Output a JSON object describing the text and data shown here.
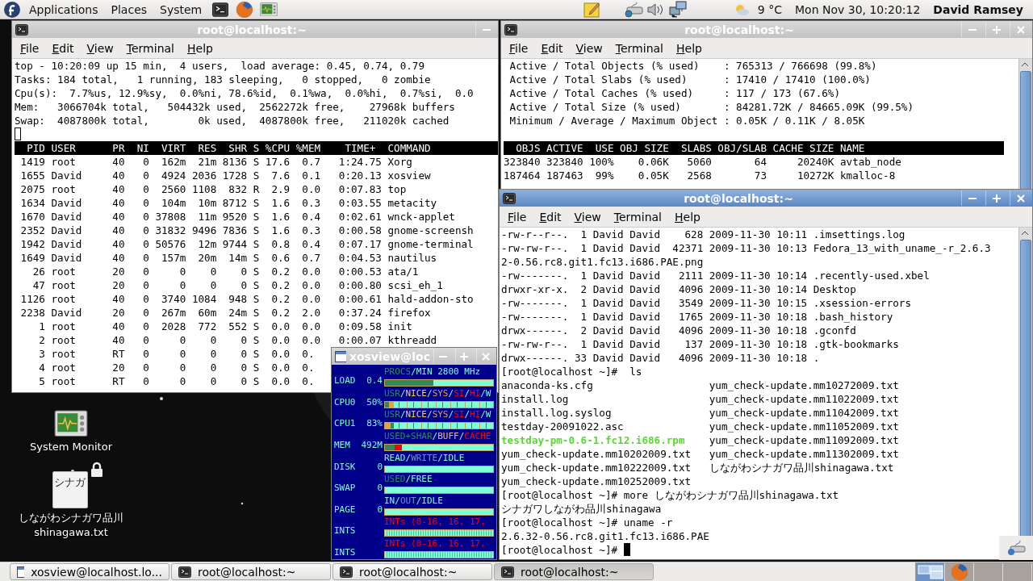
{
  "top_panel": {
    "menus": [
      "Applications",
      "Places",
      "System"
    ],
    "temperature": "9 °C",
    "clock": "Mon Nov 30, 10:20:12",
    "user": "David Ramsey"
  },
  "desktop_icons": [
    {
      "kind": "monitor",
      "label_lines": [
        "System Monitor"
      ]
    },
    {
      "kind": "file",
      "thumbnail_text": "シナガ",
      "label_lines": [
        "しながわシナガワ品川",
        "shinagawa.txt"
      ],
      "locked": true
    }
  ],
  "top_window": {
    "title": "root@localhost:~",
    "active": false,
    "menu": [
      "File",
      "Edit",
      "View",
      "Terminal",
      "Help"
    ],
    "summary": [
      "top - 10:20:09 up 15 min,  4 users,  load average: 0.45, 0.74, 0.79",
      "Tasks: 184 total,   1 running, 183 sleeping,   0 stopped,   0 zombie",
      "Cpu(s):  7.7%us, 12.9%sy,  0.0%ni, 78.6%id,  0.1%wa,  0.0%hi,  0.7%si,  0.0",
      "Mem:   3066704k total,   504432k used,  2562272k free,    27968k buffers",
      "Swap:  4087800k total,        0k used,  4087800k free,   211020k cached"
    ],
    "header": "  PID USER      PR  NI  VIRT  RES  SHR S %CPU %MEM    TIME+  COMMAND",
    "rows": [
      " 1419 root      40   0  162m  21m 8136 S 17.6  0.7   1:24.75 Xorg",
      " 1655 David     40   0  4924 2036 1728 S  7.6  0.1   0:20.13 xosview",
      " 2075 root      40   0  2560 1108  832 R  2.9  0.0   0:07.83 top",
      " 1634 David     40   0  104m  10m 8712 S  1.6  0.3   0:03.55 metacity",
      " 1670 David     40   0 37808  11m 9520 S  1.6  0.4   0:02.61 wnck-applet",
      " 2352 David     40   0 31832 9496 7836 S  1.6  0.3   0:00.58 gnome-screensh",
      " 1942 David     40   0 50576  12m 9744 S  0.8  0.4   0:07.17 gnome-terminal",
      " 1649 David     40   0  157m  20m  14m S  0.6  0.7   0:04.53 nautilus",
      "   26 root      20   0     0    0    0 S  0.2  0.0   0:00.53 ata/1",
      "   47 root      20   0     0    0    0 S  0.2  0.0   0:00.80 scsi_eh_1",
      " 1126 root      40   0  3740 1084  948 S  0.2  0.0   0:00.61 hald-addon-sto",
      " 2238 David     20   0  267m  60m  24m S  0.2  2.0   0:37.24 firefox",
      "    1 root      40   0  2028  772  552 S  0.0  0.0   0:09.58 init",
      "    2 root      40   0     0    0    0 S  0.0  0.0   0:00.07 kthreadd",
      "    3 root      RT   0     0    0    0 S  0.0  0.",
      "    4 root      20   0     0    0    0 S  0.0  0.",
      "    5 root      RT   0     0    0    0 S  0.0  0."
    ]
  },
  "slabtop_window": {
    "title": "root@localhost:~",
    "active": false,
    "menu": [
      "File",
      "Edit",
      "View",
      "Terminal",
      "Help"
    ],
    "stats": [
      " Active / Total Objects (% used)    : 765313 / 766698 (99.8%)",
      " Active / Total Slabs (% used)      : 17410 / 17410 (100.0%)",
      " Active / Total Caches (% used)     : 117 / 173 (67.6%)",
      " Active / Total Size (% used)       : 84281.72K / 84665.09K (99.5%)",
      " Minimum / Average / Maximum Object : 0.05K / 0.11K / 8.05K"
    ],
    "header": "  OBJS ACTIVE  USE OBJ SIZE  SLABS OBJ/SLAB CACHE SIZE NAME",
    "rows": [
      "323840 323840 100%    0.06K   5060       64     20240K avtab_node",
      "187464 187463  99%    0.05K   2568       73     10272K kmalloc-8"
    ]
  },
  "ls_window": {
    "title": "root@localhost:~",
    "active": true,
    "menu": [
      "File",
      "Edit",
      "View",
      "Terminal",
      "Help"
    ],
    "lines": [
      {
        "kind": "text",
        "text": "-rw-r--r--.  1 David David    628 2009-11-30 10:11 .imsettings.log"
      },
      {
        "kind": "text",
        "text": "-rw-rw-r--.  1 David David  42371 2009-11-30 10:13 Fedora_13_with_uname_-r_2.6.3"
      },
      {
        "kind": "text",
        "text": "2-0.56.rc8.git1.fc13.i686.PAE.png"
      },
      {
        "kind": "text",
        "text": "-rw-------.  1 David David   2111 2009-11-30 10:14 .recently-used.xbel"
      },
      {
        "kind": "text",
        "text": "drwxr-xr-x.  2 David David   4096 2009-11-30 10:14 Desktop"
      },
      {
        "kind": "text",
        "text": "-rw-------.  1 David David   3549 2009-11-30 10:15 .xsession-errors"
      },
      {
        "kind": "text",
        "text": "-rw-------.  1 David David   1765 2009-11-30 10:18 .bash_history"
      },
      {
        "kind": "text",
        "text": "drwx------.  2 David David   4096 2009-11-30 10:18 .gconfd"
      },
      {
        "kind": "text",
        "text": "-rw-rw-r--.  1 David David    137 2009-11-30 10:18 .gtk-bookmarks"
      },
      {
        "kind": "text",
        "text": "drwx------. 33 David David   4096 2009-11-30 10:18 ."
      },
      {
        "kind": "text",
        "text": "[root@localhost ~]#  ls"
      },
      {
        "kind": "columns",
        "cells": [
          {
            "text": "anaconda-ks.cfg",
            "executable": false
          },
          {
            "text": "yum_check-update.mm10272009.txt",
            "executable": false
          }
        ]
      },
      {
        "kind": "columns",
        "cells": [
          {
            "text": "install.log",
            "executable": false
          },
          {
            "text": "yum_check-update.mm11022009.txt",
            "executable": false
          }
        ]
      },
      {
        "kind": "columns",
        "cells": [
          {
            "text": "install.log.syslog",
            "executable": false
          },
          {
            "text": "yum_check-update.mm11042009.txt",
            "executable": false
          }
        ]
      },
      {
        "kind": "columns",
        "cells": [
          {
            "text": "testday-20091022.asc",
            "executable": false
          },
          {
            "text": "yum_check-update.mm11052009.txt",
            "executable": false
          }
        ]
      },
      {
        "kind": "columns",
        "cells": [
          {
            "text": "testday-pm-0.6-1.fc12.i686.rpm",
            "executable": true
          },
          {
            "text": "yum_check-update.mm11092009.txt",
            "executable": false
          }
        ]
      },
      {
        "kind": "columns",
        "cells": [
          {
            "text": "yum_check-update.mm10202009.txt",
            "executable": false
          },
          {
            "text": "yum_check-update.mm11302009.txt",
            "executable": false
          }
        ]
      },
      {
        "kind": "columns",
        "cells": [
          {
            "text": "yum_check-update.mm10222009.txt",
            "executable": false
          },
          {
            "text": "しながわシナガワ品川shinagawa.txt",
            "executable": false
          }
        ]
      },
      {
        "kind": "columns",
        "cells": [
          {
            "text": "yum_check-update.mm10252009.txt",
            "executable": false
          }
        ]
      },
      {
        "kind": "text",
        "text": "[root@localhost ~]# more しながわシナガワ品川shinagawa.txt"
      },
      {
        "kind": "text",
        "text": "シナガワしながわ品川shinagawa"
      },
      {
        "kind": "text",
        "text": "[root@localhost ~]# uname -r"
      },
      {
        "kind": "text",
        "text": "2.6.32-0.56.rc8.git1.fc13.i686.PAE"
      },
      {
        "kind": "prompt",
        "text": "[root@localhost ~]# "
      }
    ]
  },
  "xosview_window": {
    "title": "xosview@loc",
    "active": false,
    "meters": [
      {
        "name": "LOAD",
        "value": "0.4",
        "legend": [
          {
            "text": "PROCS",
            "color": "#2e8b57"
          },
          {
            "text": "/MIN 2800 MHz"
          }
        ],
        "bar": {
          "kind": "plain",
          "segments": [
            {
              "color": "#2e8b57",
              "level": 0.45
            }
          ]
        }
      },
      {
        "name": "CPU0",
        "value": "50%",
        "legend": [
          {
            "text": "USR",
            "color": "#2e8b57"
          },
          {
            "text": "/"
          },
          {
            "text": "NICE",
            "color": "#f0d060"
          },
          {
            "text": "/"
          },
          {
            "text": "SYS",
            "color": "#e8a040"
          },
          {
            "text": "/"
          },
          {
            "text": "SI",
            "color": "#ff0000"
          },
          {
            "text": "/"
          },
          {
            "text": "HI",
            "color": "#ff0000"
          },
          {
            "text": "/W"
          }
        ],
        "bar": {
          "kind": "speckled",
          "segments": [
            {
              "color": "#2e8b57",
              "level": 0.04
            },
            {
              "color": "#e8a040",
              "level": 0.04
            }
          ]
        }
      },
      {
        "name": "CPU1",
        "value": "83%",
        "legend": [
          {
            "text": "USR",
            "color": "#2e8b57"
          },
          {
            "text": "/"
          },
          {
            "text": "NICE",
            "color": "#f0d060"
          },
          {
            "text": "/"
          },
          {
            "text": "SYS",
            "color": "#e8a040"
          },
          {
            "text": "/"
          },
          {
            "text": "SI",
            "color": "#ff0000"
          },
          {
            "text": "/"
          },
          {
            "text": "HI",
            "color": "#ff0000"
          },
          {
            "text": "/W"
          }
        ],
        "bar": {
          "kind": "speckled",
          "segments": [
            {
              "color": "#e8a040",
              "level": 0.05
            },
            {
              "color": "#2e8b57",
              "level": 0.03
            }
          ]
        }
      },
      {
        "name": "MEM",
        "value": "492M",
        "legend": [
          {
            "text": "USED+SHAR",
            "color": "#2e8b57"
          },
          {
            "text": "/"
          },
          {
            "text": "BUFF",
            "color": "#f0c060"
          },
          {
            "text": "/"
          },
          {
            "text": "CACHE",
            "color": "#ff0000"
          }
        ],
        "bar": {
          "kind": "plain",
          "segments": [
            {
              "color": "#2e8b57",
              "level": 0.09
            },
            {
              "color": "#ff0000",
              "level": 0.07
            }
          ]
        }
      },
      {
        "name": "DISK",
        "value": "0",
        "legend": [
          {
            "text": "READ/"
          },
          {
            "text": "WRITE",
            "color": "#7090c0"
          },
          {
            "text": "/IDLE"
          }
        ],
        "bar": {
          "kind": "plain"
        }
      },
      {
        "name": "SWAP",
        "value": "0",
        "legend": [
          {
            "text": "USED",
            "color": "#2e8b57"
          },
          {
            "text": "/FREE"
          }
        ],
        "bar": {
          "kind": "plain"
        }
      },
      {
        "name": "PAGE",
        "value": "0",
        "legend": [
          {
            "text": "IN/"
          },
          {
            "text": "OUT",
            "color": "#7090c0"
          },
          {
            "text": "/IDLE"
          }
        ],
        "bar": {
          "kind": "plain"
        }
      },
      {
        "name": "INTS",
        "legend": [
          {
            "text": "INTs (0-16, 16, 17,",
            "color": "#ff0000"
          }
        ],
        "bar": {
          "kind": "striped"
        }
      },
      {
        "name": "INTS",
        "legend": [
          {
            "text": "INTs (0-16, 16, 17,",
            "color": "#ff0000"
          }
        ],
        "bar": {
          "kind": "striped"
        }
      }
    ]
  },
  "bottom_panel": {
    "tasks": [
      {
        "kind": "xosview",
        "title": "xosview@localhost.lo...",
        "selected": false
      },
      {
        "kind": "terminal",
        "title": "root@localhost:~",
        "selected": false
      },
      {
        "kind": "terminal",
        "title": "root@localhost:~",
        "selected": false
      },
      {
        "kind": "terminal",
        "title": "root@localhost:~",
        "selected": true
      }
    ],
    "workspaces": [
      {
        "kind": "windows",
        "selected": true
      },
      {
        "kind": "firefox",
        "selected": false
      },
      {
        "kind": "empty",
        "selected": false
      },
      {
        "kind": "empty",
        "selected": false
      }
    ]
  }
}
